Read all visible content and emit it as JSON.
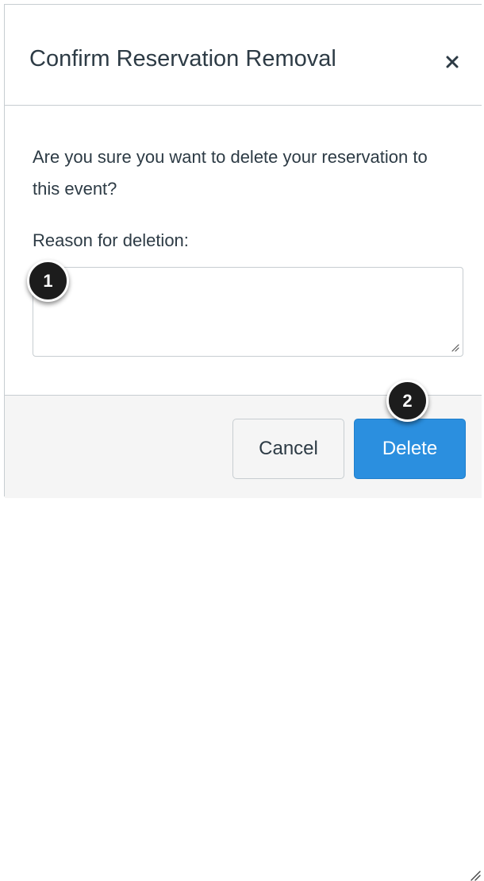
{
  "dialog": {
    "title": "Confirm Reservation Removal",
    "close_icon": "close-icon",
    "close_glyph": "×",
    "question": "Are you sure you want to delete your reservation to this event?",
    "reason_label": "Reason for deletion:",
    "reason_value": "",
    "reason_placeholder": ""
  },
  "footer": {
    "cancel_label": "Cancel",
    "delete_label": "Delete"
  },
  "callouts": {
    "one": "1",
    "two": "2"
  },
  "colors": {
    "primary": "#2b8fdf",
    "text": "#2d3b45",
    "border": "#c7cdd1",
    "footer_bg": "#f5f5f5",
    "callout_bg": "#1c1c1c"
  }
}
